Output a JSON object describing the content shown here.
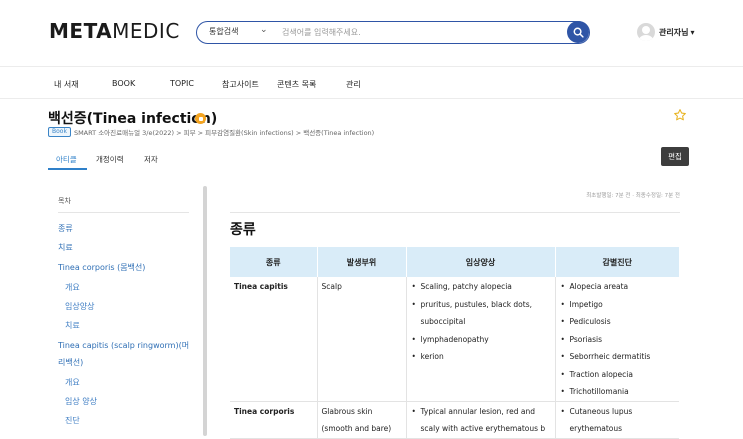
{
  "header": {
    "logo_bold": "META",
    "logo_light": "MEDIC",
    "search": {
      "scope": "통합검색",
      "placeholder": "검색어를 입력해주세요.",
      "icon": "search-icon"
    },
    "user_name": "관리자님",
    "user_caret": "▾"
  },
  "nav": [
    "내 서재",
    "BOOK",
    "TOPIC",
    "참고사이트",
    "콘텐츠 목록",
    "관리"
  ],
  "title": "백선증(Tinea infection)",
  "breadcrumb": {
    "tag": "Book",
    "path": "SMART 소아진료매뉴얼 3/e(2022) > 피부 > 피부감염질환(Skin infections) > 백선증(Tinea infection)"
  },
  "tabs": [
    "아티클",
    "개정이력",
    "저자"
  ],
  "edit_label": "편집",
  "toc": {
    "heading": "목차",
    "items": [
      "종류",
      "치료",
      "Tinea corporis (몸백선)",
      "개요",
      "임상양상",
      "치료",
      "Tinea capitis (scalp ringworm)(머리백선)",
      "개요",
      "임상 양상",
      "진단"
    ]
  },
  "meta_line": "최초발행일: 7분 전 · 최종수정일: 7분 전",
  "section_title": "종류",
  "table": {
    "headers": [
      "종류",
      "발생부위",
      "임상양상",
      "감별진단"
    ],
    "rows": [
      {
        "name": "Tinea capitis",
        "site": "Scalp",
        "clinical": [
          "Scaling, patchy alopecia",
          "pruritus, pustules, black dots, suboccipital",
          "lymphadenopathy",
          "kerion"
        ],
        "ddx": [
          "Alopecia areata",
          "Impetigo",
          "Pediculosis",
          "Psoriasis",
          "Seborrheic dermatitis",
          "Traction alopecia",
          "Trichotillomania"
        ]
      },
      {
        "name": "Tinea corporis",
        "site": "Glabrous skin (smooth and bare)",
        "clinical": [
          "Typical annular lesion, red and scaly with active erythematous b"
        ],
        "ddx": [
          "Cutaneous lupus erythematous"
        ]
      }
    ]
  },
  "colors": {
    "brand_blue": "#2f55a6",
    "link_blue": "#2f6fb5",
    "header_cell": "#d9ecf8",
    "badge_orange": "#f4a420",
    "star_gold": "#e8b321"
  }
}
